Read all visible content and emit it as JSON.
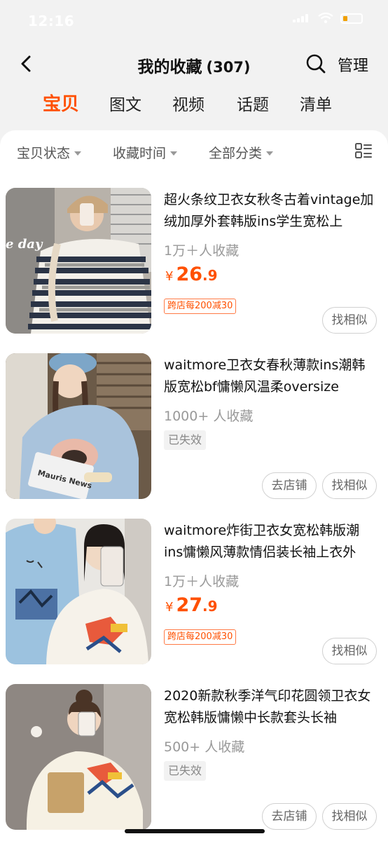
{
  "status": {
    "time": "12:16"
  },
  "nav": {
    "title": "我的收藏",
    "count": "(307)",
    "manage_label": "管理"
  },
  "tabs": [
    {
      "label": "宝贝",
      "active": true
    },
    {
      "label": "图文",
      "active": false
    },
    {
      "label": "视频",
      "active": false
    },
    {
      "label": "话题",
      "active": false
    },
    {
      "label": "清单",
      "active": false
    }
  ],
  "filters": [
    "宝贝状态",
    "收藏时间",
    "全部分类"
  ],
  "items": [
    {
      "title": "超火条纹卫衣女秋冬古着vintage加绒加厚外套韩版ins学生宽松上",
      "collected": "1万＋人收藏",
      "price_symbol": "¥",
      "price_int": "26",
      "price_dec": ".9",
      "promo": "跨店每200减30",
      "similar_label": "找相似"
    },
    {
      "title": "waitmore卫衣女春秋薄款ins潮韩版宽松bf慵懒风温柔oversize",
      "collected": "1000+ 人收藏",
      "status": "已失效",
      "store_label": "去店铺",
      "similar_label": "找相似"
    },
    {
      "title": "waitmore炸街卫衣女宽松韩版潮ins慵懒风薄款情侣装长袖上衣外",
      "collected": "1万＋人收藏",
      "price_symbol": "¥",
      "price_int": "27",
      "price_dec": ".9",
      "promo": "跨店每200减30",
      "similar_label": "找相似"
    },
    {
      "title": "2020新款秋季洋气印花圆领卫衣女宽松韩版慵懒中长款套头长袖",
      "collected": "500+ 人收藏",
      "status": "已失效",
      "store_label": "去店铺",
      "similar_label": "找相似"
    }
  ],
  "thumb_text": {
    "photo1_overlay": "e day",
    "photo2_newspaper": "Mauris News"
  },
  "colors": {
    "accent": "#ff5000",
    "background": "#f2f2f2"
  }
}
